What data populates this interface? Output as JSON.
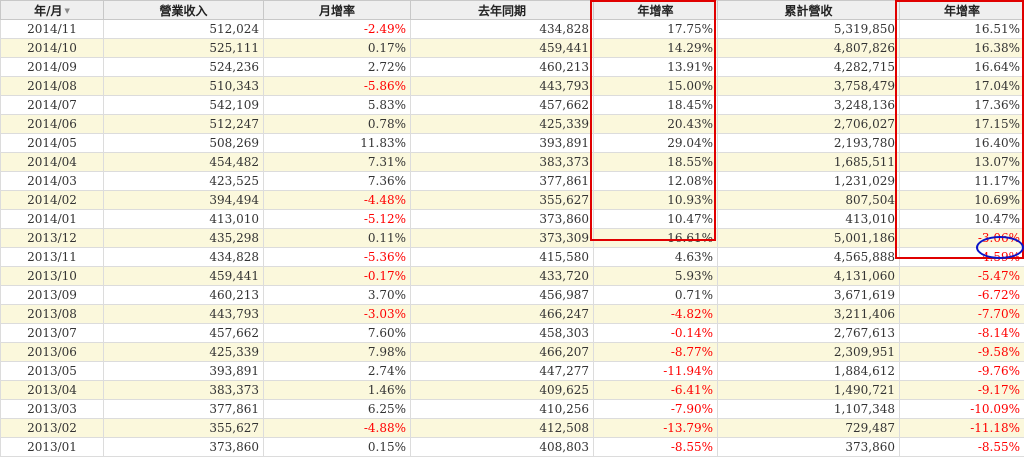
{
  "headers": {
    "month": "年/月",
    "revenue": "營業收入",
    "mom": "月增率",
    "last_year": "去年同期",
    "yoy": "年增率",
    "cumulative": "累計營收",
    "cum_yoy": "年增率"
  },
  "rows": [
    [
      "2014/11",
      "512,024",
      "-2.49%",
      "434,828",
      "17.75%",
      "5,319,850",
      "16.51%"
    ],
    [
      "2014/10",
      "525,111",
      "0.17%",
      "459,441",
      "14.29%",
      "4,807,826",
      "16.38%"
    ],
    [
      "2014/09",
      "524,236",
      "2.72%",
      "460,213",
      "13.91%",
      "4,282,715",
      "16.64%"
    ],
    [
      "2014/08",
      "510,343",
      "-5.86%",
      "443,793",
      "15.00%",
      "3,758,479",
      "17.04%"
    ],
    [
      "2014/07",
      "542,109",
      "5.83%",
      "457,662",
      "18.45%",
      "3,248,136",
      "17.36%"
    ],
    [
      "2014/06",
      "512,247",
      "0.78%",
      "425,339",
      "20.43%",
      "2,706,027",
      "17.15%"
    ],
    [
      "2014/05",
      "508,269",
      "11.83%",
      "393,891",
      "29.04%",
      "2,193,780",
      "16.40%"
    ],
    [
      "2014/04",
      "454,482",
      "7.31%",
      "383,373",
      "18.55%",
      "1,685,511",
      "13.07%"
    ],
    [
      "2014/03",
      "423,525",
      "7.36%",
      "377,861",
      "12.08%",
      "1,231,029",
      "11.17%"
    ],
    [
      "2014/02",
      "394,494",
      "-4.48%",
      "355,627",
      "10.93%",
      "807,504",
      "10.69%"
    ],
    [
      "2014/01",
      "413,010",
      "-5.12%",
      "373,860",
      "10.47%",
      "413,010",
      "10.47%"
    ],
    [
      "2013/12",
      "435,298",
      "0.11%",
      "373,309",
      "16.61%",
      "5,001,186",
      "-3.06%"
    ],
    [
      "2013/11",
      "434,828",
      "-5.36%",
      "415,580",
      "4.63%",
      "4,565,888",
      "-4.59%"
    ],
    [
      "2013/10",
      "459,441",
      "-0.17%",
      "433,720",
      "5.93%",
      "4,131,060",
      "-5.47%"
    ],
    [
      "2013/09",
      "460,213",
      "3.70%",
      "456,987",
      "0.71%",
      "3,671,619",
      "-6.72%"
    ],
    [
      "2013/08",
      "443,793",
      "-3.03%",
      "466,247",
      "-4.82%",
      "3,211,406",
      "-7.70%"
    ],
    [
      "2013/07",
      "457,662",
      "7.60%",
      "458,303",
      "-0.14%",
      "2,767,613",
      "-8.14%"
    ],
    [
      "2013/06",
      "425,339",
      "7.98%",
      "466,207",
      "-8.77%",
      "2,309,951",
      "-9.58%"
    ],
    [
      "2013/05",
      "393,891",
      "2.74%",
      "447,277",
      "-11.94%",
      "1,884,612",
      "-9.76%"
    ],
    [
      "2013/04",
      "383,373",
      "1.46%",
      "409,625",
      "-6.41%",
      "1,490,721",
      "-9.17%"
    ],
    [
      "2013/03",
      "377,861",
      "6.25%",
      "410,256",
      "-7.90%",
      "1,107,348",
      "-10.09%"
    ],
    [
      "2013/02",
      "355,627",
      "-4.88%",
      "412,508",
      "-13.79%",
      "729,487",
      "-11.18%"
    ],
    [
      "2013/01",
      "373,860",
      "0.15%",
      "408,803",
      "-8.55%",
      "373,860",
      "-8.55%"
    ]
  ],
  "colors": {
    "negative": "#ff0000",
    "highlight_box": "#e00000",
    "highlight_circle": "#0a14c8",
    "row_alt": "#fbf8dc",
    "header_bg": "#efefef"
  },
  "icons": {
    "sort": "sort-arrow-icon"
  }
}
